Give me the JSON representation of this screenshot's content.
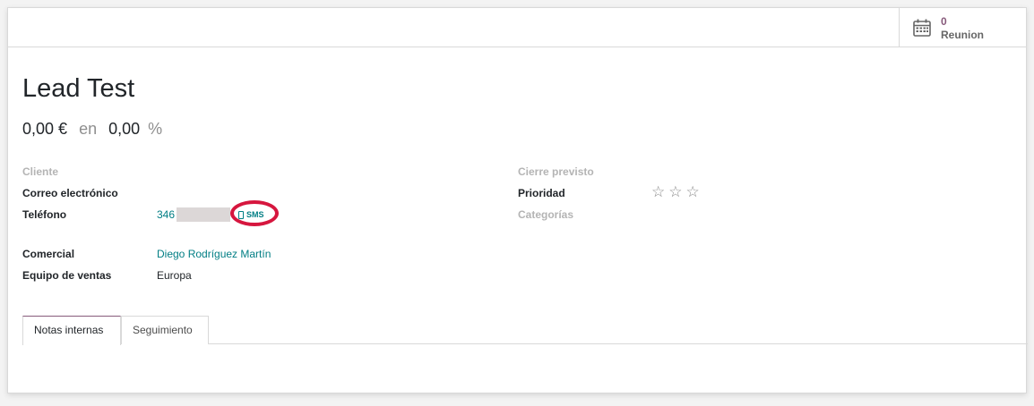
{
  "stat_button": {
    "value": "0",
    "label": "Reunion",
    "icon": "calendar-icon"
  },
  "lead": {
    "title": "Lead Test",
    "expected_revenue": "0,00 €",
    "connector": "en",
    "probability": "0,00",
    "percent_sign": "%"
  },
  "left_fields": {
    "cliente_label": "Cliente",
    "email_label": "Correo electrónico",
    "phone_label": "Teléfono",
    "phone_value": "346",
    "sms_label": "SMS",
    "comercial_label": "Comercial",
    "comercial_value": "Diego Rodríguez Martín",
    "equipo_label": "Equipo de ventas",
    "equipo_value": "Europa"
  },
  "right_fields": {
    "cierre_label": "Cierre previsto",
    "prioridad_label": "Prioridad",
    "prioridad_stars": 0,
    "prioridad_max": 3,
    "categorias_label": "Categorías"
  },
  "tabs": [
    {
      "label": "Notas internas",
      "active": true
    },
    {
      "label": "Seguimiento",
      "active": false
    }
  ],
  "colors": {
    "brand": "#875a7b",
    "link": "#017e84",
    "highlight_circle": "#d6163e"
  }
}
